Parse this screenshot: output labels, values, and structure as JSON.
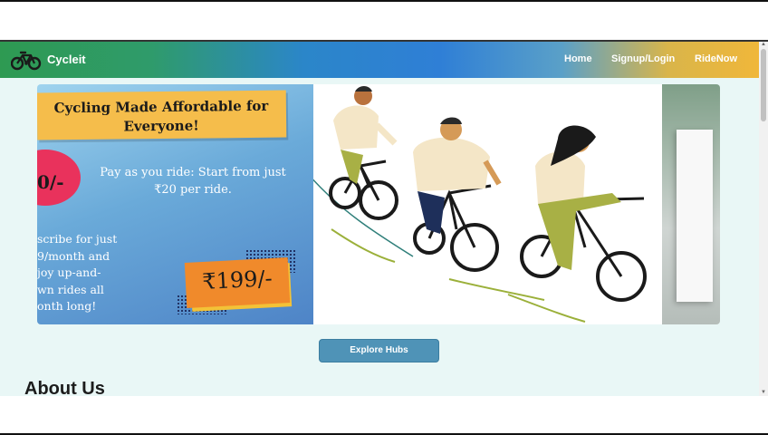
{
  "navbar": {
    "brand": "Cycleit",
    "links": [
      "Home",
      "Signup/Login",
      "RideNow"
    ],
    "colors": {
      "start": "#2e9a52",
      "middle": "#2f7fd6",
      "end": "#f0b73a"
    }
  },
  "carousel": {
    "headline": "Cycling Made Affordable for Everyone!",
    "badge_price": "0/-",
    "pay_text": "Pay as you ride: Start from just ₹20 per ride.",
    "subscribe_lines": [
      "scribe for just",
      "9/month and",
      "joy up-and-",
      "wn rides all",
      "onth long!"
    ],
    "price": "₹199/-"
  },
  "explore_button": "Explore Hubs",
  "about_title": "About Us",
  "icons": [
    "bicycle-logo-icon",
    "scroll-up-icon",
    "scroll-down-icon"
  ]
}
